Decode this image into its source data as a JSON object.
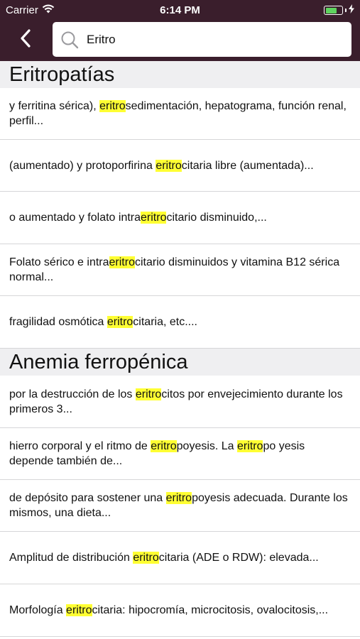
{
  "status_bar": {
    "carrier": "Carrier",
    "time": "6:14 PM",
    "icons": [
      "wifi-icon",
      "battery-icon",
      "charging-icon"
    ]
  },
  "nav": {
    "back_icon": "chevron-left-icon",
    "search_icon": "search-icon",
    "search_value": "Eritro"
  },
  "colors": {
    "nav_background": "#3a1e2c",
    "highlight": "#ffff33",
    "section_background": "#efeff1"
  },
  "sections": [
    {
      "title": "Eritropatías",
      "results": [
        [
          {
            "t": "y ferritina sérica), "
          },
          {
            "t": "eritro",
            "hl": true
          },
          {
            "t": "sedimentación, hepatograma, función renal, perfil..."
          }
        ],
        [
          {
            "t": "(aumentado) y protoporfirina "
          },
          {
            "t": "eritro",
            "hl": true
          },
          {
            "t": "citaria libre (aumentada)..."
          }
        ],
        [
          {
            "t": "o aumentado y folato intra"
          },
          {
            "t": "eritro",
            "hl": true
          },
          {
            "t": "citario disminuido,..."
          }
        ],
        [
          {
            "t": "Folato sérico e intra"
          },
          {
            "t": "eritro",
            "hl": true
          },
          {
            "t": "citario disminuidos y vitamina B12 sérica normal..."
          }
        ],
        [
          {
            "t": "fragilidad osmótica "
          },
          {
            "t": "eritro",
            "hl": true
          },
          {
            "t": "citaria, etc...."
          }
        ]
      ]
    },
    {
      "title": "Anemia ferropénica",
      "results": [
        [
          {
            "t": "por la destrucción de los "
          },
          {
            "t": "eritro",
            "hl": true
          },
          {
            "t": "citos por envejecimiento durante los primeros 3..."
          }
        ],
        [
          {
            "t": "hierro corporal y el ritmo de "
          },
          {
            "t": "eritro",
            "hl": true
          },
          {
            "t": "poyesis. La "
          },
          {
            "t": "eritro",
            "hl": true
          },
          {
            "t": "po yesis depende también de..."
          }
        ],
        [
          {
            "t": "de depósito para sostener una "
          },
          {
            "t": "eritro",
            "hl": true
          },
          {
            "t": "poyesis adecuada. Durante los mismos, una dieta..."
          }
        ],
        [
          {
            "t": "Amplitud de distribución "
          },
          {
            "t": "eritro",
            "hl": true
          },
          {
            "t": "citaria (ADE o RDW): elevada..."
          }
        ],
        [
          {
            "t": "Morfología "
          },
          {
            "t": "eritro",
            "hl": true
          },
          {
            "t": "citaria: hipocromía, microcitosis, ovalocitosis,..."
          }
        ]
      ]
    }
  ]
}
